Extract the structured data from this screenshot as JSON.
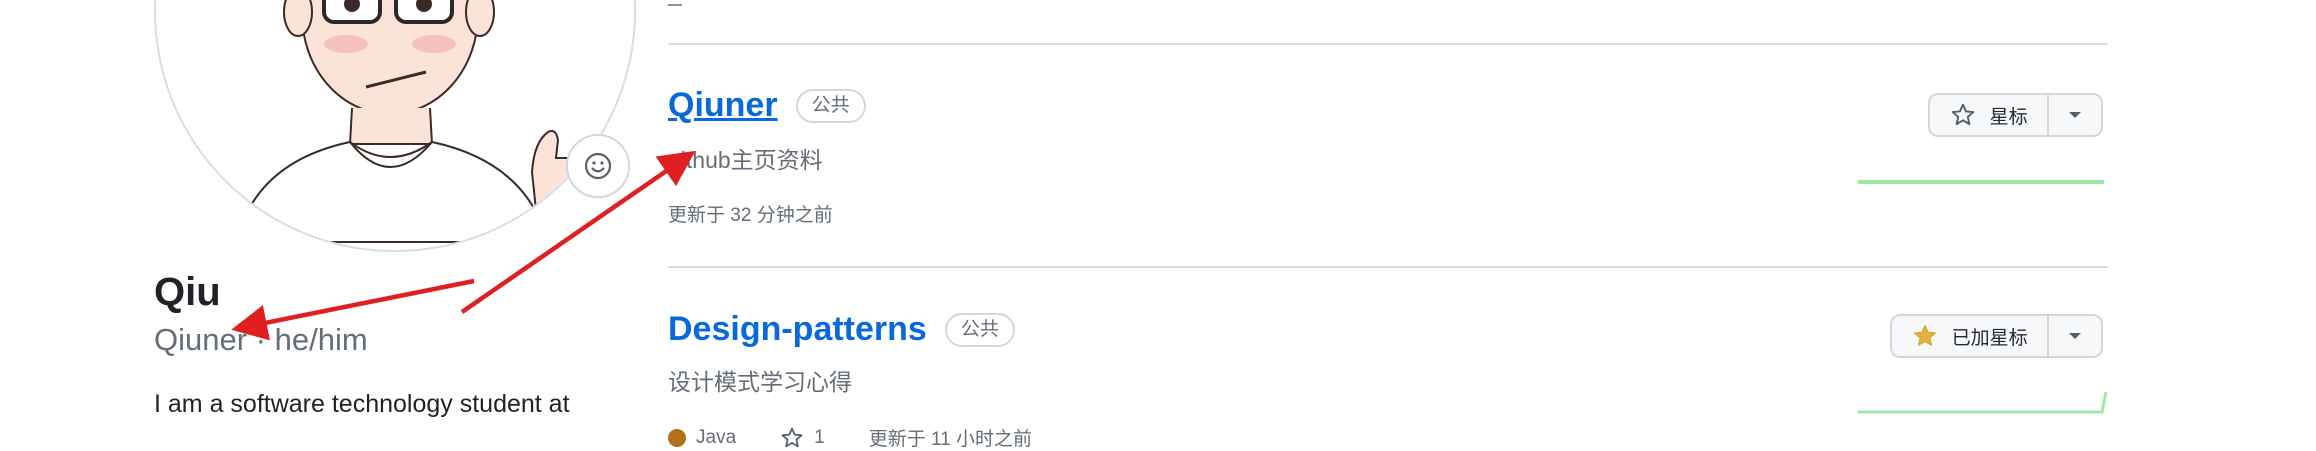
{
  "profile": {
    "name": "Qiu",
    "username": "Qiuner",
    "pronouns": "he/him",
    "separator": " · ",
    "bio_start": "I am a software technology student at"
  },
  "repos": [
    {
      "name": "Qiuner",
      "visibility": "公共",
      "description": "github主页资料",
      "updated": "更新于 32 分钟之前",
      "star_label": "星标",
      "starred": false
    },
    {
      "name": "Design-patterns",
      "visibility": "公共",
      "description": "设计模式学习心得",
      "language": "Java",
      "language_color": "#b07219",
      "stars": "1",
      "updated": "更新于 11 小时之前",
      "star_label": "已加星标",
      "starred": true
    }
  ],
  "colors": {
    "link": "#0969da",
    "annotation_arrow": "#e02020",
    "spark": "#9be9a8",
    "star_filled": "#e3b341"
  },
  "icons": [
    "smiley-icon",
    "star-outline-icon",
    "star-filled-icon",
    "caret-down-icon",
    "star-icon"
  ]
}
